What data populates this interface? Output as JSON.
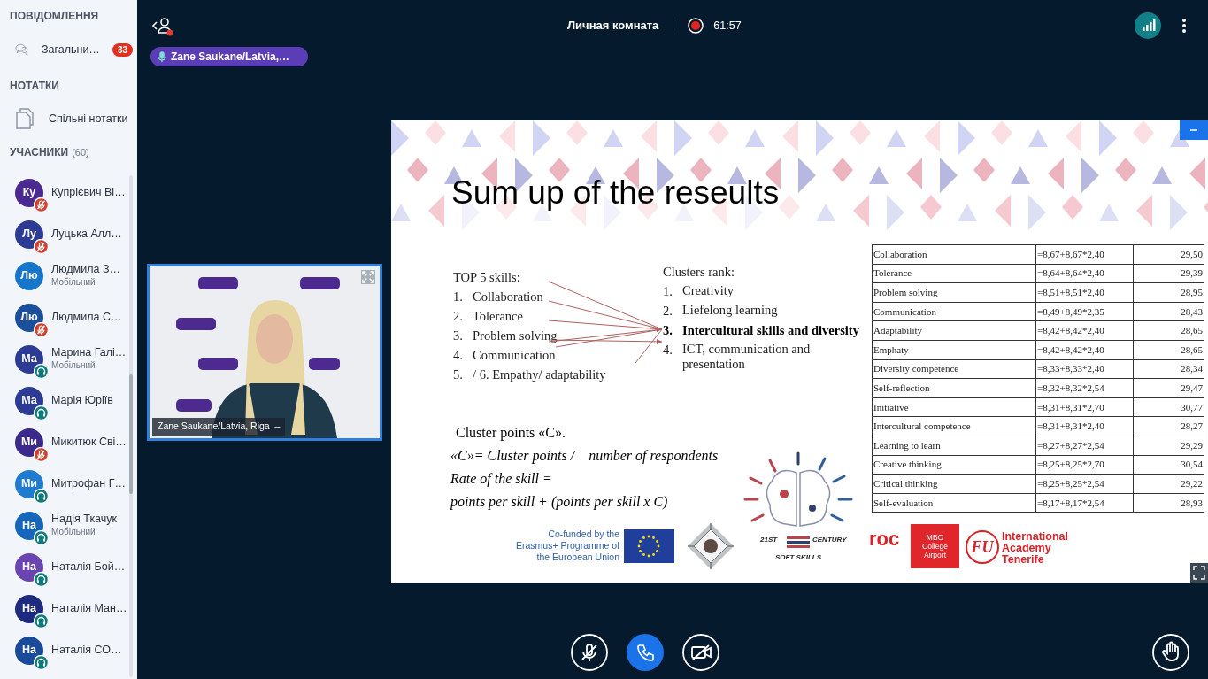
{
  "sidebar": {
    "messages_heading": "ПОВІДОМЛЕННЯ",
    "chats": [
      {
        "label": "Загальни…",
        "badge": "33"
      }
    ],
    "notes_heading": "НОТАТКИ",
    "notes": [
      {
        "label": "Спільні нотатки"
      }
    ],
    "participants_heading": "УЧАСНИКИ",
    "participants_count": "(60)",
    "participants": [
      {
        "initials": "Ку",
        "name": "Купрієвич Ві…",
        "kind": "muted",
        "color": "#4a2a8e"
      },
      {
        "initials": "Лу",
        "name": "Луцька Алл…",
        "kind": "muted",
        "color": "#2c3b94"
      },
      {
        "initials": "Лю",
        "name": "Людмила З…",
        "subtitle": "Мобільний",
        "kind": "none",
        "color": "#1676c9"
      },
      {
        "initials": "Лю",
        "name": "Людмила С…",
        "kind": "muted",
        "color": "#1b4f9c"
      },
      {
        "initials": "Ма",
        "name": "Марина Галі…",
        "subtitle": "Мобільний",
        "kind": "headphones",
        "color": "#2c3b94"
      },
      {
        "initials": "Ма",
        "name": "Марія Юріїв",
        "kind": "headphones",
        "color": "#2c3b94"
      },
      {
        "initials": "Ми",
        "name": "Микитюк Сві…",
        "kind": "muted",
        "color": "#3b2a8c"
      },
      {
        "initials": "Ми",
        "name": "Митрофан Г…",
        "kind": "headphones",
        "color": "#1e7bd1"
      },
      {
        "initials": "На",
        "name": "Надія Ткачук",
        "subtitle": "Мобільний",
        "kind": "headphones",
        "color": "#1667b9"
      },
      {
        "initials": "На",
        "name": "Наталія Бой…",
        "kind": "headphones",
        "color": "#6a45b1"
      },
      {
        "initials": "На",
        "name": "Наталія Ман…",
        "kind": "headphones",
        "color": "#1d2a7d"
      },
      {
        "initials": "На",
        "name": "Наталія СО…",
        "kind": "headphones",
        "color": "#1a4b9b"
      }
    ]
  },
  "top_bar": {
    "speaker_pill": "Zane Saukane/Latvia,…",
    "room_title": "Личная комната",
    "timer": "61:57"
  },
  "video_tile": {
    "name": "Zane Saukane/Latvia, Riga  –"
  },
  "presentation": {
    "title": "Sum up of the reseults",
    "skills_heading": "TOP 5 skills:",
    "skills": [
      {
        "number": "1.",
        "label": "Collaboration"
      },
      {
        "number": "2.",
        "label": "Tolerance"
      },
      {
        "number": "3.",
        "label": "Problem solving"
      },
      {
        "number": "4.",
        "label": "Communication"
      },
      {
        "number": "5.",
        "label": "/ 6. Empathy/ adaptability"
      }
    ],
    "clusters_heading": "Clusters rank:",
    "clusters": [
      {
        "number": "1.",
        "label": "Creativity",
        "emphasized": false
      },
      {
        "number": "2.",
        "label": "Liefelong learning",
        "emphasized": false
      },
      {
        "number": "3.",
        "label": "Intercultural skills and diversity",
        "emphasized": true
      },
      {
        "number": "4.",
        "label": "ICT, communication and presentation",
        "emphasized": false
      }
    ],
    "cluster_points": "Cluster points «C».",
    "formula_lines": [
      "«C»= Cluster points /    number of respondents",
      "Rate of the skill =",
      "points per skill + (points per skill x C)"
    ],
    "table": {
      "rows": [
        {
          "skill": "Collaboration",
          "formula": "=8,67+8,67*2,40",
          "rate": "29,50"
        },
        {
          "skill": "Tolerance",
          "formula": "=8,64+8,64*2,40",
          "rate": "29,39"
        },
        {
          "skill": "Problem solving",
          "formula": "=8,51+8,51*2,40",
          "rate": "28,95"
        },
        {
          "skill": "Communication",
          "formula": "=8,49+8,49*2,35",
          "rate": "28,43"
        },
        {
          "skill": "Adaptability",
          "formula": "=8,42+8,42*2,40",
          "rate": "28,65"
        },
        {
          "skill": "Emphaty",
          "formula": "=8,42+8,42*2,40",
          "rate": "28,65"
        },
        {
          "skill": "Diversity competence",
          "formula": "=8,33+8,33*2,40",
          "rate": "28,34"
        },
        {
          "skill": "Self-reflection",
          "formula": "=8,32+8,32*2,54",
          "rate": "29,47"
        },
        {
          "skill": "Initiative",
          "formula": "=8,31+8,31*2,70",
          "rate": "30,77"
        },
        {
          "skill": "Intercultural competence",
          "formula": "=8,31+8,31*2,40",
          "rate": "28,27"
        },
        {
          "skill": "Learning to learn",
          "formula": "=8,27+8,27*2,54",
          "rate": "29,29"
        },
        {
          "skill": "Creative thinking",
          "formula": "=8,25+8,25*2,70",
          "rate": "30,54"
        },
        {
          "skill": "Critical thinking",
          "formula": "=8,25+8,25*2,54",
          "rate": "29,22"
        },
        {
          "skill": "Self-evaluation",
          "formula": "=8,17+8,17*2,54",
          "rate": "28,93"
        }
      ]
    },
    "erasmus_text": "Co-funded by the Erasmus+ Programme of the European Union",
    "soft_skills": {
      "left": "21ST",
      "right": "CENTURY",
      "bottom": "SOFT SKILLS"
    },
    "roc_logo": "roc",
    "mbo_logo": "MBO College Airport",
    "academy_monogram": "FU",
    "academy_name": "International Academy Tenerife"
  }
}
